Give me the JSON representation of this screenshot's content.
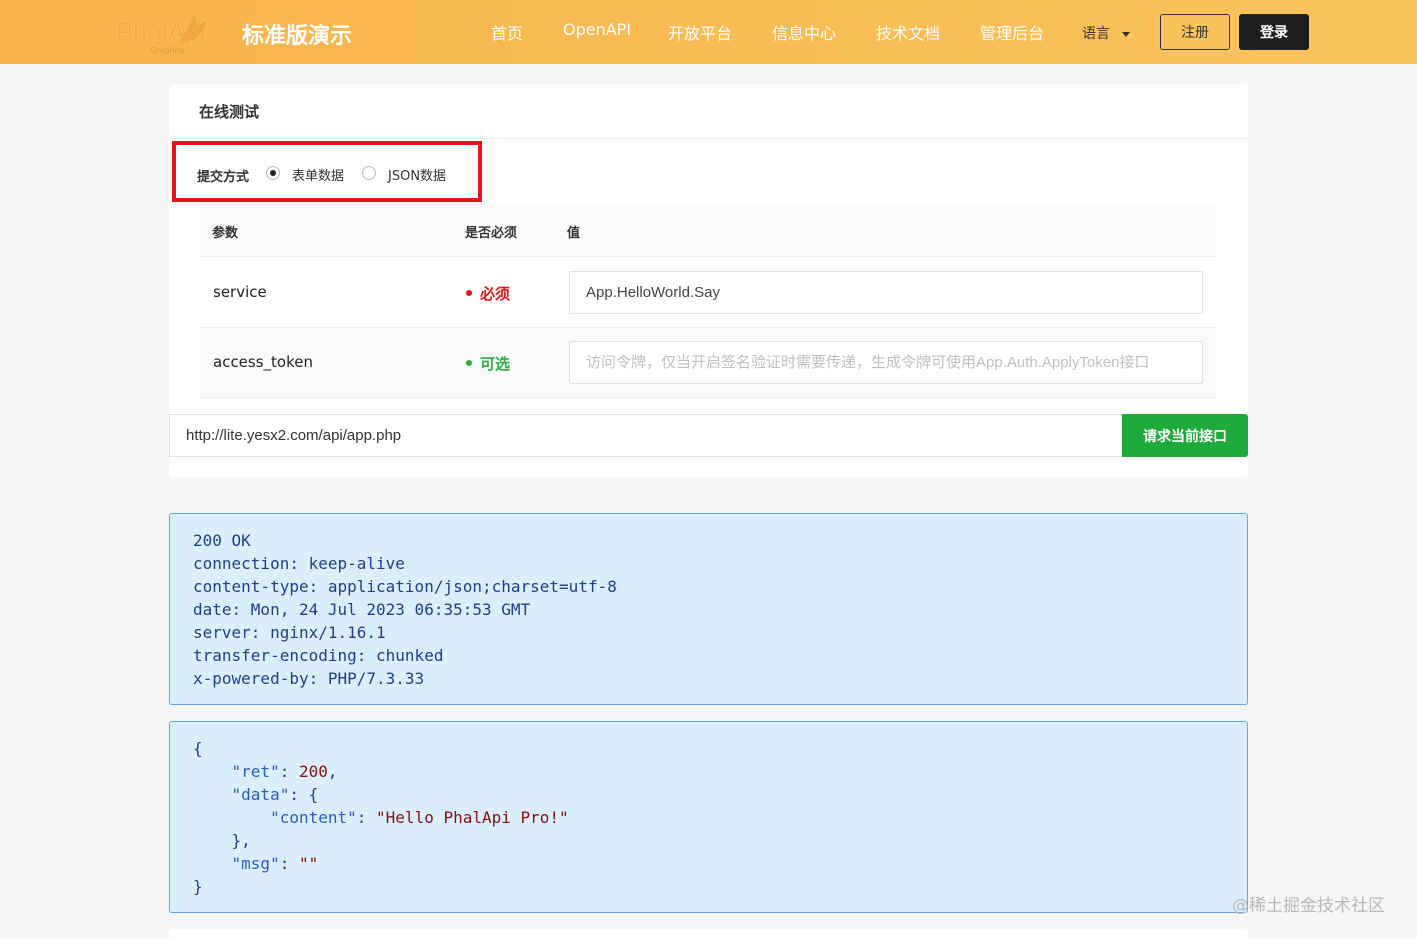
{
  "header": {
    "logo_word": "PhalApi",
    "logo_sub": "Graphite",
    "site_title": "标准版演示",
    "nav": [
      "首页",
      "OpenAPI",
      "开放平台",
      "信息中心",
      "技术文档",
      "管理后台"
    ],
    "language": "语言",
    "register": "注册",
    "login": "登录"
  },
  "card": {
    "title": "在线测试",
    "submit": {
      "label": "提交方式",
      "options": [
        "表单数据",
        "JSON数据"
      ],
      "selected": "表单数据"
    },
    "table": {
      "headers": [
        "参数",
        "是否必须",
        "值"
      ],
      "rows": [
        {
          "name": "service",
          "requirement": "必须",
          "value": "App.HelloWorld.Say",
          "placeholder": ""
        },
        {
          "name": "access_token",
          "requirement": "可选",
          "value": "",
          "placeholder": "访问令牌，仅当开启签名验证时需要传递，生成令牌可使用App.Auth.ApplyToken接口"
        }
      ]
    },
    "url": "http://lite.yesx2.com/api/app.php",
    "request_button": "请求当前接口"
  },
  "response": {
    "headers": [
      "200 OK",
      "connection: keep-alive",
      "content-type: application/json;charset=utf-8",
      "date: Mon, 24 Jul 2023 06:35:53 GMT",
      "server: nginx/1.16.1",
      "transfer-encoding: chunked",
      "x-powered-by: PHP/7.3.33"
    ],
    "body": {
      "open": "{",
      "ret_key": "\"ret\"",
      "ret_val": "200",
      "data_key": "\"data\"",
      "data_open": "{",
      "content_key": "\"content\"",
      "content_val": "\"Hello PhalApi Pro!\"",
      "data_close": "},",
      "msg_key": "\"msg\"",
      "msg_val": "\"\"",
      "close": "}"
    }
  },
  "watermark": "@稀土掘金技术社区",
  "colors": {
    "header": "#f9bd55",
    "required": "#e8141b",
    "optional": "#2eaa3e",
    "request_button": "#1faa3c",
    "highlight_box": "#e8141b",
    "response_bg": "#dbeefb"
  }
}
